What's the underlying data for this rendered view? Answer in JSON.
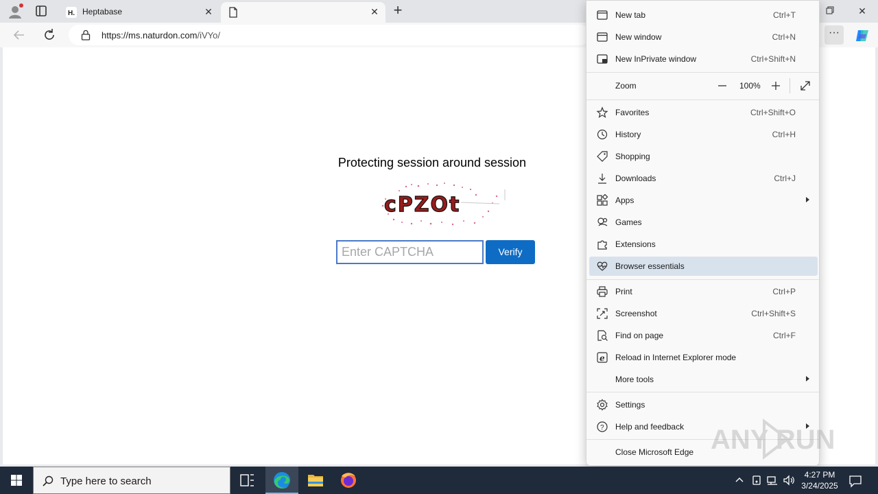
{
  "browser": {
    "tabs": [
      {
        "title": "Heptabase",
        "favicon": "heptabase-icon"
      },
      {
        "title": "",
        "favicon": "page-icon"
      }
    ],
    "url_host": "https://ms.naturdon.com",
    "url_path": "/iVYo/"
  },
  "page": {
    "heading": "Protecting session around session",
    "captcha_text": "cPZOt",
    "captcha_placeholder": "Enter CAPTCHA",
    "verify_label": "Verify"
  },
  "menu": {
    "items": [
      {
        "label": "New tab",
        "shortcut": "Ctrl+T",
        "icon": "new-tab-icon"
      },
      {
        "label": "New window",
        "shortcut": "Ctrl+N",
        "icon": "new-window-icon"
      },
      {
        "label": "New InPrivate window",
        "shortcut": "Ctrl+Shift+N",
        "icon": "inprivate-icon"
      },
      {
        "label": "Zoom",
        "value": "100%"
      },
      {
        "label": "Favorites",
        "shortcut": "Ctrl+Shift+O",
        "icon": "star-icon"
      },
      {
        "label": "History",
        "shortcut": "Ctrl+H",
        "icon": "history-icon"
      },
      {
        "label": "Shopping",
        "shortcut": "",
        "icon": "tag-icon"
      },
      {
        "label": "Downloads",
        "shortcut": "Ctrl+J",
        "icon": "download-icon"
      },
      {
        "label": "Apps",
        "shortcut": "",
        "icon": "apps-icon"
      },
      {
        "label": "Games",
        "shortcut": "",
        "icon": "games-icon"
      },
      {
        "label": "Extensions",
        "shortcut": "",
        "icon": "puzzle-icon"
      },
      {
        "label": "Browser essentials",
        "shortcut": "",
        "icon": "heart-pulse-icon"
      },
      {
        "label": "Print",
        "shortcut": "Ctrl+P",
        "icon": "printer-icon"
      },
      {
        "label": "Screenshot",
        "shortcut": "Ctrl+Shift+S",
        "icon": "screenshot-icon"
      },
      {
        "label": "Find on page",
        "shortcut": "Ctrl+F",
        "icon": "find-icon"
      },
      {
        "label": "Reload in Internet Explorer mode",
        "shortcut": "",
        "icon": "ie-icon"
      },
      {
        "label": "More tools",
        "shortcut": ""
      },
      {
        "label": "Settings",
        "shortcut": "",
        "icon": "gear-icon"
      },
      {
        "label": "Help and feedback",
        "shortcut": "",
        "icon": "help-icon"
      },
      {
        "label": "Close Microsoft Edge",
        "shortcut": ""
      }
    ]
  },
  "taskbar": {
    "search_placeholder": "Type here to search",
    "time": "4:27 PM",
    "date": "3/24/2025"
  },
  "watermark": "ANY RUN",
  "colors": {
    "accent": "#0f6cc4",
    "menu_highlight": "#d8e2ed",
    "taskbar": "#1f2a3a",
    "captcha_text": "#9b1c1c"
  }
}
